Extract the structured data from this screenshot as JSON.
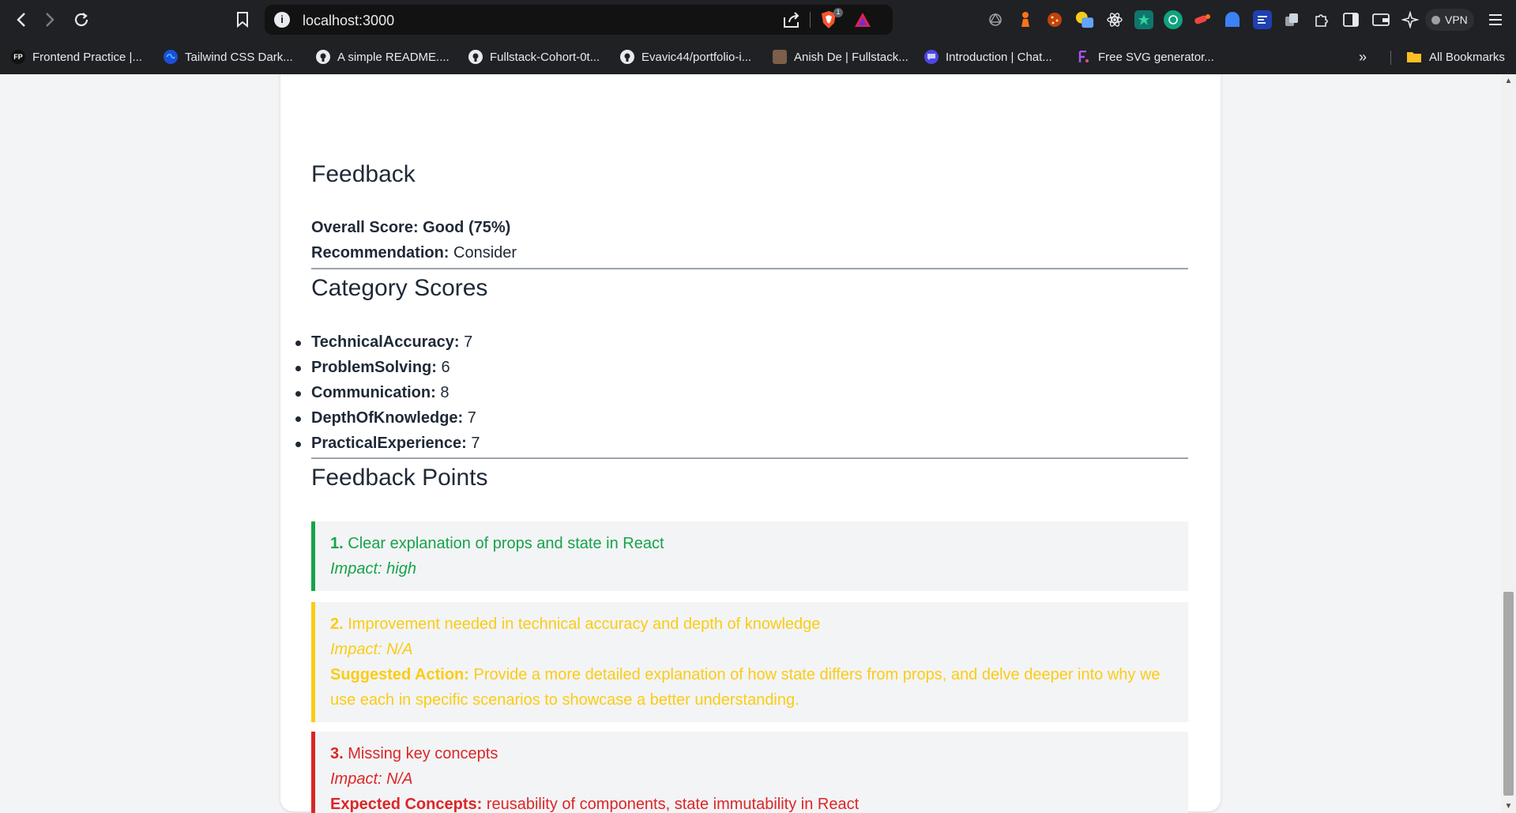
{
  "browser": {
    "url": "localhost:3000",
    "shield_badge": "1",
    "vpn_label": "VPN",
    "bookmarks": [
      {
        "label": "Frontend Practice |...",
        "icon": "FP"
      },
      {
        "label": "Tailwind CSS Dark...",
        "icon": "tailwind-icon"
      },
      {
        "label": "A simple README....",
        "icon": "github-icon"
      },
      {
        "label": "Fullstack-Cohort-0t...",
        "icon": "github-icon"
      },
      {
        "label": "Evavic44/portfolio-i...",
        "icon": "github-icon"
      },
      {
        "label": "Anish De | Fullstack...",
        "icon": "avatar-icon"
      },
      {
        "label": "Introduction | Chat...",
        "icon": "chat-icon"
      },
      {
        "label": "Free SVG generator...",
        "icon": "svg-icon"
      }
    ],
    "all_bookmarks_label": "All Bookmarks"
  },
  "feedback": {
    "title": "Feedback",
    "overall_label": "Overall Score: Good (75%)",
    "recommendation_label": "Recommendation:",
    "recommendation_value": "Consider"
  },
  "category_scores": {
    "title": "Category Scores",
    "items": [
      {
        "name": "TechnicalAccuracy:",
        "score": "7"
      },
      {
        "name": "ProblemSolving:",
        "score": "6"
      },
      {
        "name": "Communication:",
        "score": "8"
      },
      {
        "name": "DepthOfKnowledge:",
        "score": "7"
      },
      {
        "name": "PracticalExperience:",
        "score": "7"
      }
    ]
  },
  "feedback_points": {
    "title": "Feedback Points",
    "items": [
      {
        "number": "1.",
        "text": "Clear explanation of props and state in React",
        "impact": "Impact: high",
        "color": "#16a34a"
      },
      {
        "number": "2.",
        "text": "Improvement needed in technical accuracy and depth of knowledge",
        "impact": "Impact: N/A",
        "extra_label": "Suggested Action:",
        "extra_text": "Provide a more detailed explanation of how state differs from props, and delve deeper into why we use each in specific scenarios to showcase a better understanding.",
        "color": "#facc15"
      },
      {
        "number": "3.",
        "text": "Missing key concepts",
        "impact": "Impact: N/A",
        "extra_label": "Expected Concepts:",
        "extra_text": "reusability of components, state immutability in React",
        "color": "#dc2626"
      }
    ]
  }
}
